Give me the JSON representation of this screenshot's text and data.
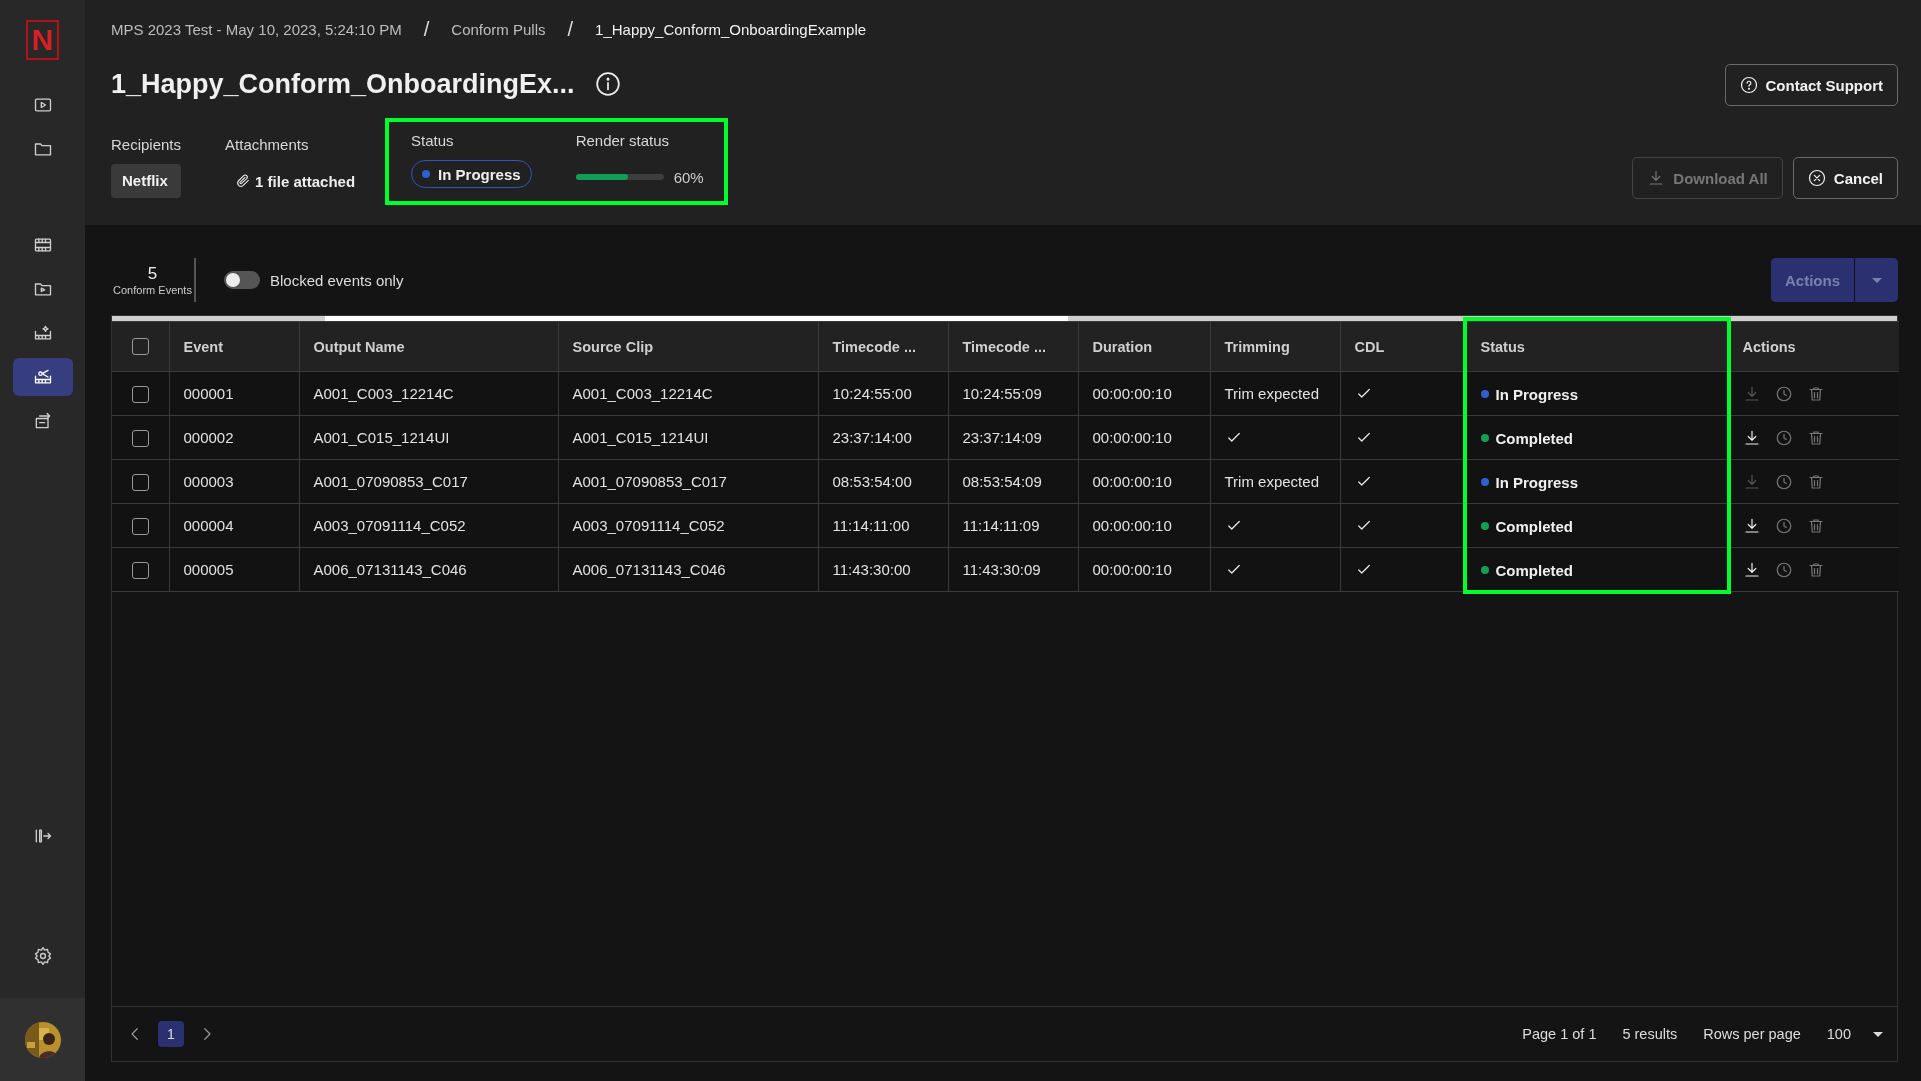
{
  "sidebar": {
    "logo": "N",
    "items": [
      {
        "selected": false
      },
      {
        "selected": false
      },
      {
        "selected": false
      },
      {
        "selected": false
      },
      {
        "selected": false
      },
      {
        "selected": true
      },
      {
        "selected": false
      }
    ]
  },
  "breadcrumbs": [
    {
      "label": "MPS 2023 Test - May 10, 2023, 5:24:10 PM",
      "current": false
    },
    {
      "label": "Conform Pulls",
      "current": false
    },
    {
      "label": "1_Happy_Conform_OnboardingExample",
      "current": true
    }
  ],
  "breadcrumb_separator": "/",
  "title": "1_Happy_Conform_OnboardingEx...",
  "recipients": {
    "label": "Recipients",
    "value": "Netflix"
  },
  "attachments": {
    "label": "Attachments",
    "value": "1 file attached"
  },
  "status": {
    "label": "Status",
    "value": "In Progress",
    "color": "#2f5fd0",
    "highlighted": true
  },
  "render_status": {
    "label": "Render status",
    "level": 0.6,
    "reading": "60%"
  },
  "contact_button": {
    "label": "Contact Support"
  },
  "download_all_button": {
    "label": "Download All",
    "disabled": true
  },
  "cancel_button": {
    "label": "Cancel",
    "disabled": false
  },
  "summary": {
    "count": "5",
    "label": "Conform Events"
  },
  "blocked_toggle": {
    "label": "Blocked events only",
    "on": false
  },
  "actions_button": {
    "label": "Actions",
    "disabled": true
  },
  "table": {
    "all_checked": false,
    "columns": [
      {
        "label": "Event",
        "highlighted": false
      },
      {
        "label": "Output Name",
        "highlighted": false
      },
      {
        "label": "Source Clip",
        "highlighted": false
      },
      {
        "label": "Timecode ...",
        "highlighted": false
      },
      {
        "label": "Timecode ...",
        "highlighted": false
      },
      {
        "label": "Duration",
        "highlighted": false
      },
      {
        "label": "Trimming",
        "highlighted": false
      },
      {
        "label": "CDL",
        "highlighted": false
      },
      {
        "label": "Status",
        "highlighted": true
      },
      {
        "label": "Actions",
        "highlighted": false
      }
    ],
    "rows": [
      {
        "checked": false,
        "event": "000001",
        "output_name": "A001_C003_12214C",
        "source_clip": "A001_C003_12214C",
        "timecode_1": "10:24:55:00",
        "timecode_2": "10:24:55:09",
        "duration": "00:00:00:10",
        "trimming": {
          "kind": "text",
          "text": "Trim expected"
        },
        "cdl": true,
        "status": "In Progress",
        "color": "#2f5fd0",
        "download_disabled": true
      },
      {
        "checked": false,
        "event": "000002",
        "output_name": "A001_C015_1214UI",
        "source_clip": "A001_C015_1214UI",
        "timecode_1": "23:37:14:00",
        "timecode_2": "23:37:14:09",
        "duration": "00:00:00:10",
        "trimming": {
          "kind": "check"
        },
        "cdl": true,
        "status": "Completed",
        "color": "#12a150",
        "download_disabled": false
      },
      {
        "checked": false,
        "event": "000003",
        "output_name": "A001_07090853_C017",
        "source_clip": "A001_07090853_C017",
        "timecode_1": "08:53:54:00",
        "timecode_2": "08:53:54:09",
        "duration": "00:00:00:10",
        "trimming": {
          "kind": "text",
          "text": "Trim expected"
        },
        "cdl": true,
        "status": "In Progress",
        "color": "#2f5fd0",
        "download_disabled": true
      },
      {
        "checked": false,
        "event": "000004",
        "output_name": "A003_07091114_C052",
        "source_clip": "A003_07091114_C052",
        "timecode_1": "11:14:11:00",
        "timecode_2": "11:14:11:09",
        "duration": "00:00:00:10",
        "trimming": {
          "kind": "check"
        },
        "cdl": true,
        "status": "Completed",
        "color": "#12a150",
        "download_disabled": false
      },
      {
        "checked": false,
        "event": "000005",
        "output_name": "A006_07131143_C046",
        "source_clip": "A006_07131143_C046",
        "timecode_1": "11:43:30:00",
        "timecode_2": "11:43:30:09",
        "duration": "00:00:00:10",
        "trimming": {
          "kind": "check"
        },
        "cdl": true,
        "status": "Completed",
        "color": "#12a150",
        "download_disabled": false
      }
    ]
  },
  "pagination": {
    "pages": [
      {
        "label": "1",
        "selected": true
      }
    ],
    "page_info": "Page 1 of 1",
    "results": "5 results",
    "rows_per_page_label": "Rows per page",
    "rows_per_page": "100"
  }
}
